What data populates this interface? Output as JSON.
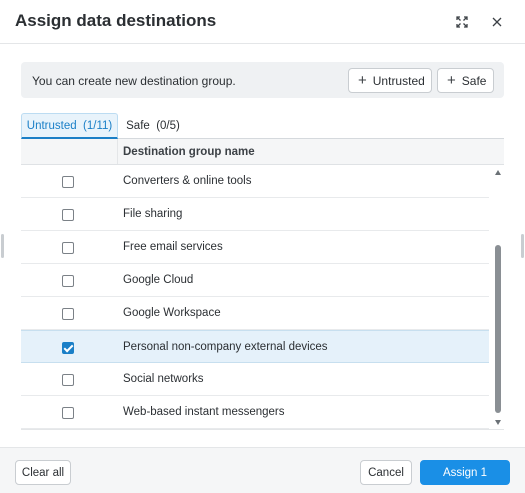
{
  "dialog": {
    "title": "Assign data destinations",
    "icons": {
      "expand": "expand-icon",
      "close": "close-icon"
    }
  },
  "banner": {
    "text": "You can create new destination group.",
    "untrusted_button": "Untrusted",
    "safe_button": "Safe",
    "plus_glyph": "+"
  },
  "tabs": [
    {
      "label": "Untrusted  (1/11)",
      "active": true
    },
    {
      "label": "Safe  (0/5)",
      "active": false
    }
  ],
  "table": {
    "column_header": "Destination group name",
    "rows": [
      {
        "label": "Converters & online tools",
        "checked": false
      },
      {
        "label": "File sharing",
        "checked": false
      },
      {
        "label": "Free email services",
        "checked": false
      },
      {
        "label": "Google Cloud",
        "checked": false
      },
      {
        "label": "Google Workspace",
        "checked": false
      },
      {
        "label": "Personal non-company external devices",
        "checked": true
      },
      {
        "label": "Social networks",
        "checked": false
      },
      {
        "label": "Web-based instant messengers",
        "checked": false
      }
    ]
  },
  "footer": {
    "clear_all": "Clear all",
    "cancel": "Cancel",
    "assign": "Assign 1"
  },
  "colors": {
    "accent": "#1a8fe6",
    "tab_active_text": "#1a7fc7",
    "selected_row": "#e5f1fa"
  }
}
